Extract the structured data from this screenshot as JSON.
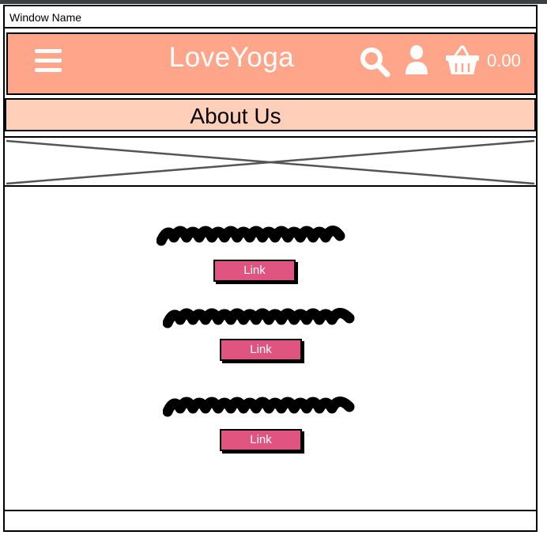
{
  "window": {
    "title": "Window Name"
  },
  "header": {
    "logo": "LoveYoga",
    "cart_total": "0.00",
    "icons": [
      "menu-icon",
      "search-icon",
      "user-icon",
      "basket-icon"
    ],
    "background_color": "#ffa58a"
  },
  "subheader": {
    "title": "About Us",
    "background_color": "#ffcfb9"
  },
  "content": {
    "links": [
      {
        "label": "Link"
      },
      {
        "label": "Link"
      },
      {
        "label": "Link"
      }
    ],
    "link_color": "#df5481"
  }
}
